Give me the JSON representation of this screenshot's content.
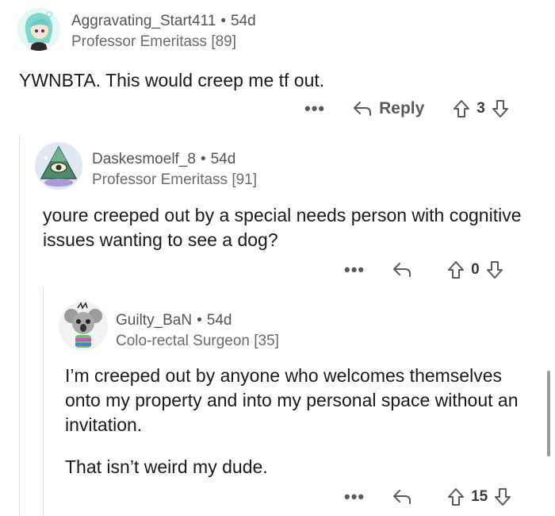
{
  "comments": [
    {
      "username": "Aggravating_Start411",
      "age": "54d",
      "flair": "Professor Emeritass [89]",
      "body": [
        "YWNBTA. This would creep me tf out."
      ],
      "reply_label": "Reply",
      "score": "3",
      "avatar_icon": "anime-girl-avatar-icon"
    },
    {
      "username": "Daskesmoelf_8",
      "age": "54d",
      "flair": "Professor Emeritass [91]",
      "body": [
        "youre creeped out by a special needs person with cognitive issues wanting to see a dog?"
      ],
      "reply_label": "",
      "score": "0",
      "avatar_icon": "pyramid-eye-avatar-icon"
    },
    {
      "username": "Guilty_BaN",
      "age": "54d",
      "flair": "Colo-rectal Surgeon [35]",
      "body": [
        "I’m creeped out by anyone who welcomes themselves onto my property and into my personal space without an invitation.",
        "That isn’t weird my dude."
      ],
      "reply_label": "",
      "score": "15",
      "avatar_icon": "koala-avatar-icon"
    }
  ],
  "more_label": "•••",
  "colors": {
    "text": "#1a1a1b",
    "meta": "#545454",
    "thread_line": "#e0e0e0"
  }
}
